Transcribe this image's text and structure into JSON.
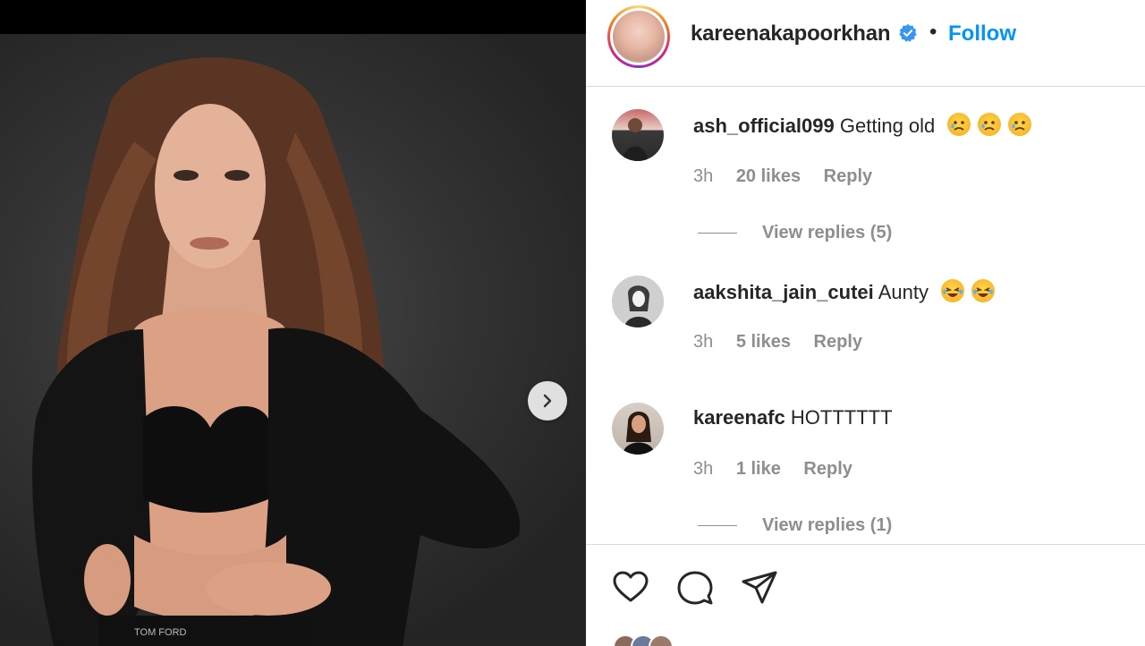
{
  "post": {
    "owner_username": "kareenakapoorkhan",
    "separator": "•",
    "follow_label": "Follow"
  },
  "comments": [
    {
      "username": "ash_official099",
      "text": "Getting old",
      "emoji": [
        "sad-tear-emoji",
        "sad-tear-emoji",
        "sad-tear-emoji"
      ],
      "time": "3h",
      "likes": "20 likes",
      "reply_label": "Reply",
      "view_replies": "View replies (5)"
    },
    {
      "username": "aakshita_jain_cutei",
      "text": "Aunty",
      "emoji": [
        "laughing-emoji",
        "laughing-emoji"
      ],
      "time": "3h",
      "likes": "5 likes",
      "reply_label": "Reply"
    },
    {
      "username": "kareenafc",
      "text": "HOTTTTTT",
      "time": "3h",
      "likes": "1 like",
      "reply_label": "Reply",
      "view_replies": "View replies (1)"
    }
  ],
  "actions": {
    "like_icon": "heart-icon",
    "comment_icon": "comment-icon",
    "share_icon": "send-icon"
  },
  "colors": {
    "follow_blue": "#0095f6",
    "verified_blue": "#3897f0",
    "meta_gray": "#8e8e8e",
    "divider": "#dbdbdb"
  }
}
